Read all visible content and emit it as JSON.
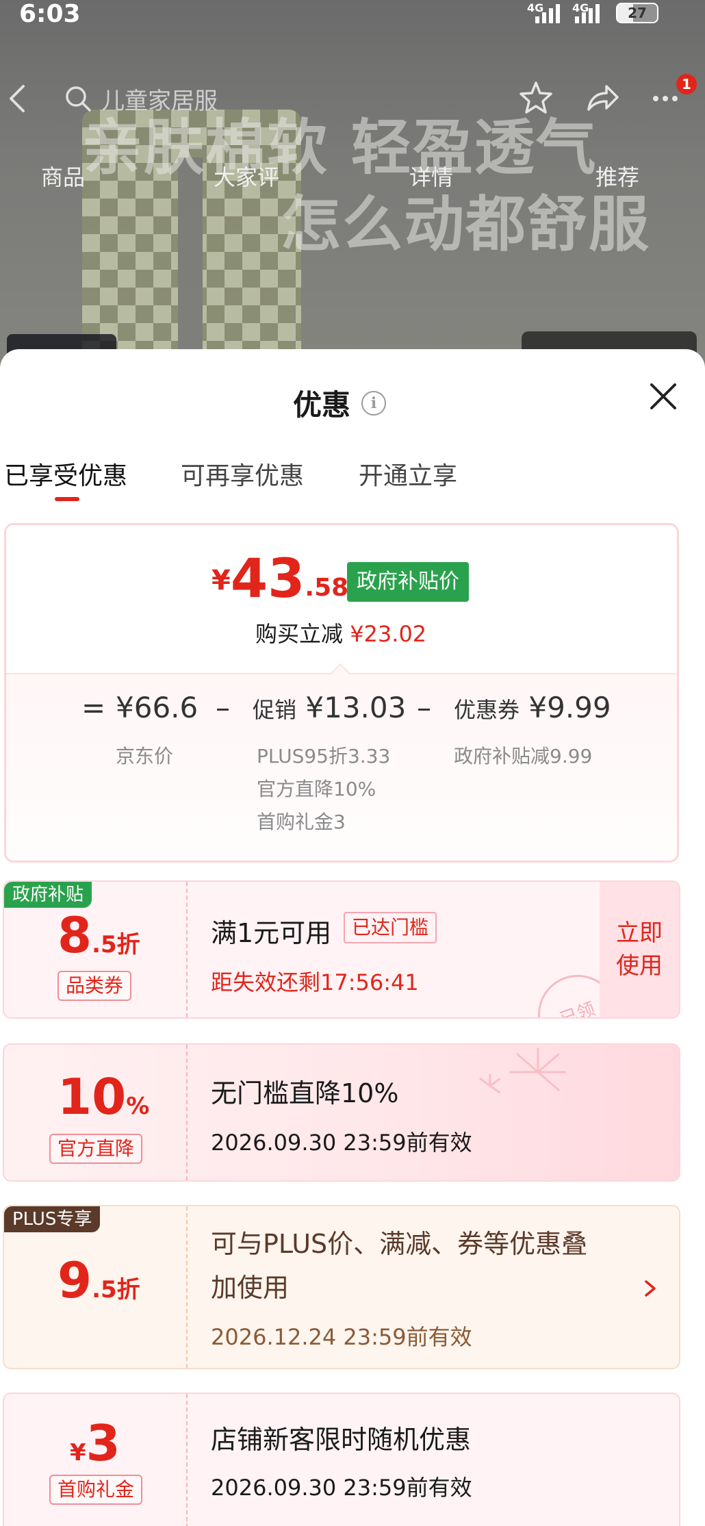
{
  "status_bar": {
    "time": "6:03",
    "signal1": "4G",
    "signal2": "4G",
    "battery": "27"
  },
  "nav": {
    "search_text": "儿童家居服",
    "more_badge": "1",
    "tabs": [
      "商品",
      "大家评",
      "详情",
      "推荐"
    ]
  },
  "background": {
    "headline_line1": "亲肤棉软 轻盈透气",
    "headline_line2": "怎么动都舒服"
  },
  "sheet": {
    "title": "优惠",
    "sub_tabs": [
      "已享受优惠",
      "可再享优惠",
      "开通立享"
    ]
  },
  "summary": {
    "currency": "¥",
    "price_int": "43",
    "price_dec": ".58",
    "gov_tag": "政府补贴价",
    "buy_prefix": "购买立减",
    "buy_amount": "¥23.02",
    "eq": "=",
    "minus": "–",
    "base_price": "¥66.6",
    "base_label": "京东价",
    "promo_label": "促销",
    "promo_amount": "¥13.03",
    "promo_items": [
      "PLUS95折3.33",
      "官方直降10%",
      "首购礼金3"
    ],
    "coupon_label": "优惠券",
    "coupon_amount": "¥9.99",
    "coupon_item": "政府补贴减9.99"
  },
  "coupons": [
    {
      "ribbon": "政府补贴",
      "big": "8",
      "small": ".5折",
      "pill": "品类券",
      "title": "满1元可用",
      "state": "已达门槛",
      "subtitle": "距失效还剩17:56:41",
      "action_line1": "立即",
      "action_line2": "使用",
      "stamp": "已领"
    },
    {
      "big": "10",
      "small": "%",
      "pill": "官方直降",
      "title": "无门槛直降10%",
      "date": "2026.09.30 23:59前有效"
    },
    {
      "ribbon": "PLUS专享",
      "big": "9",
      "small": ".5折",
      "title_line1": "可与PLUS价、满减、券等优惠叠",
      "title_line2": "加使用",
      "date": "2026.12.24 23:59前有效"
    },
    {
      "cur": "¥",
      "big": "3",
      "pill": "首购礼金",
      "title": "店铺新客限时随机优惠",
      "date": "2026.09.30 23:59前有效"
    }
  ],
  "colors": {
    "accent": "#e1251b",
    "gov_green": "#2aa24d",
    "plus_brown": "#5b3a2a",
    "plus_text": "#8a5a35"
  }
}
